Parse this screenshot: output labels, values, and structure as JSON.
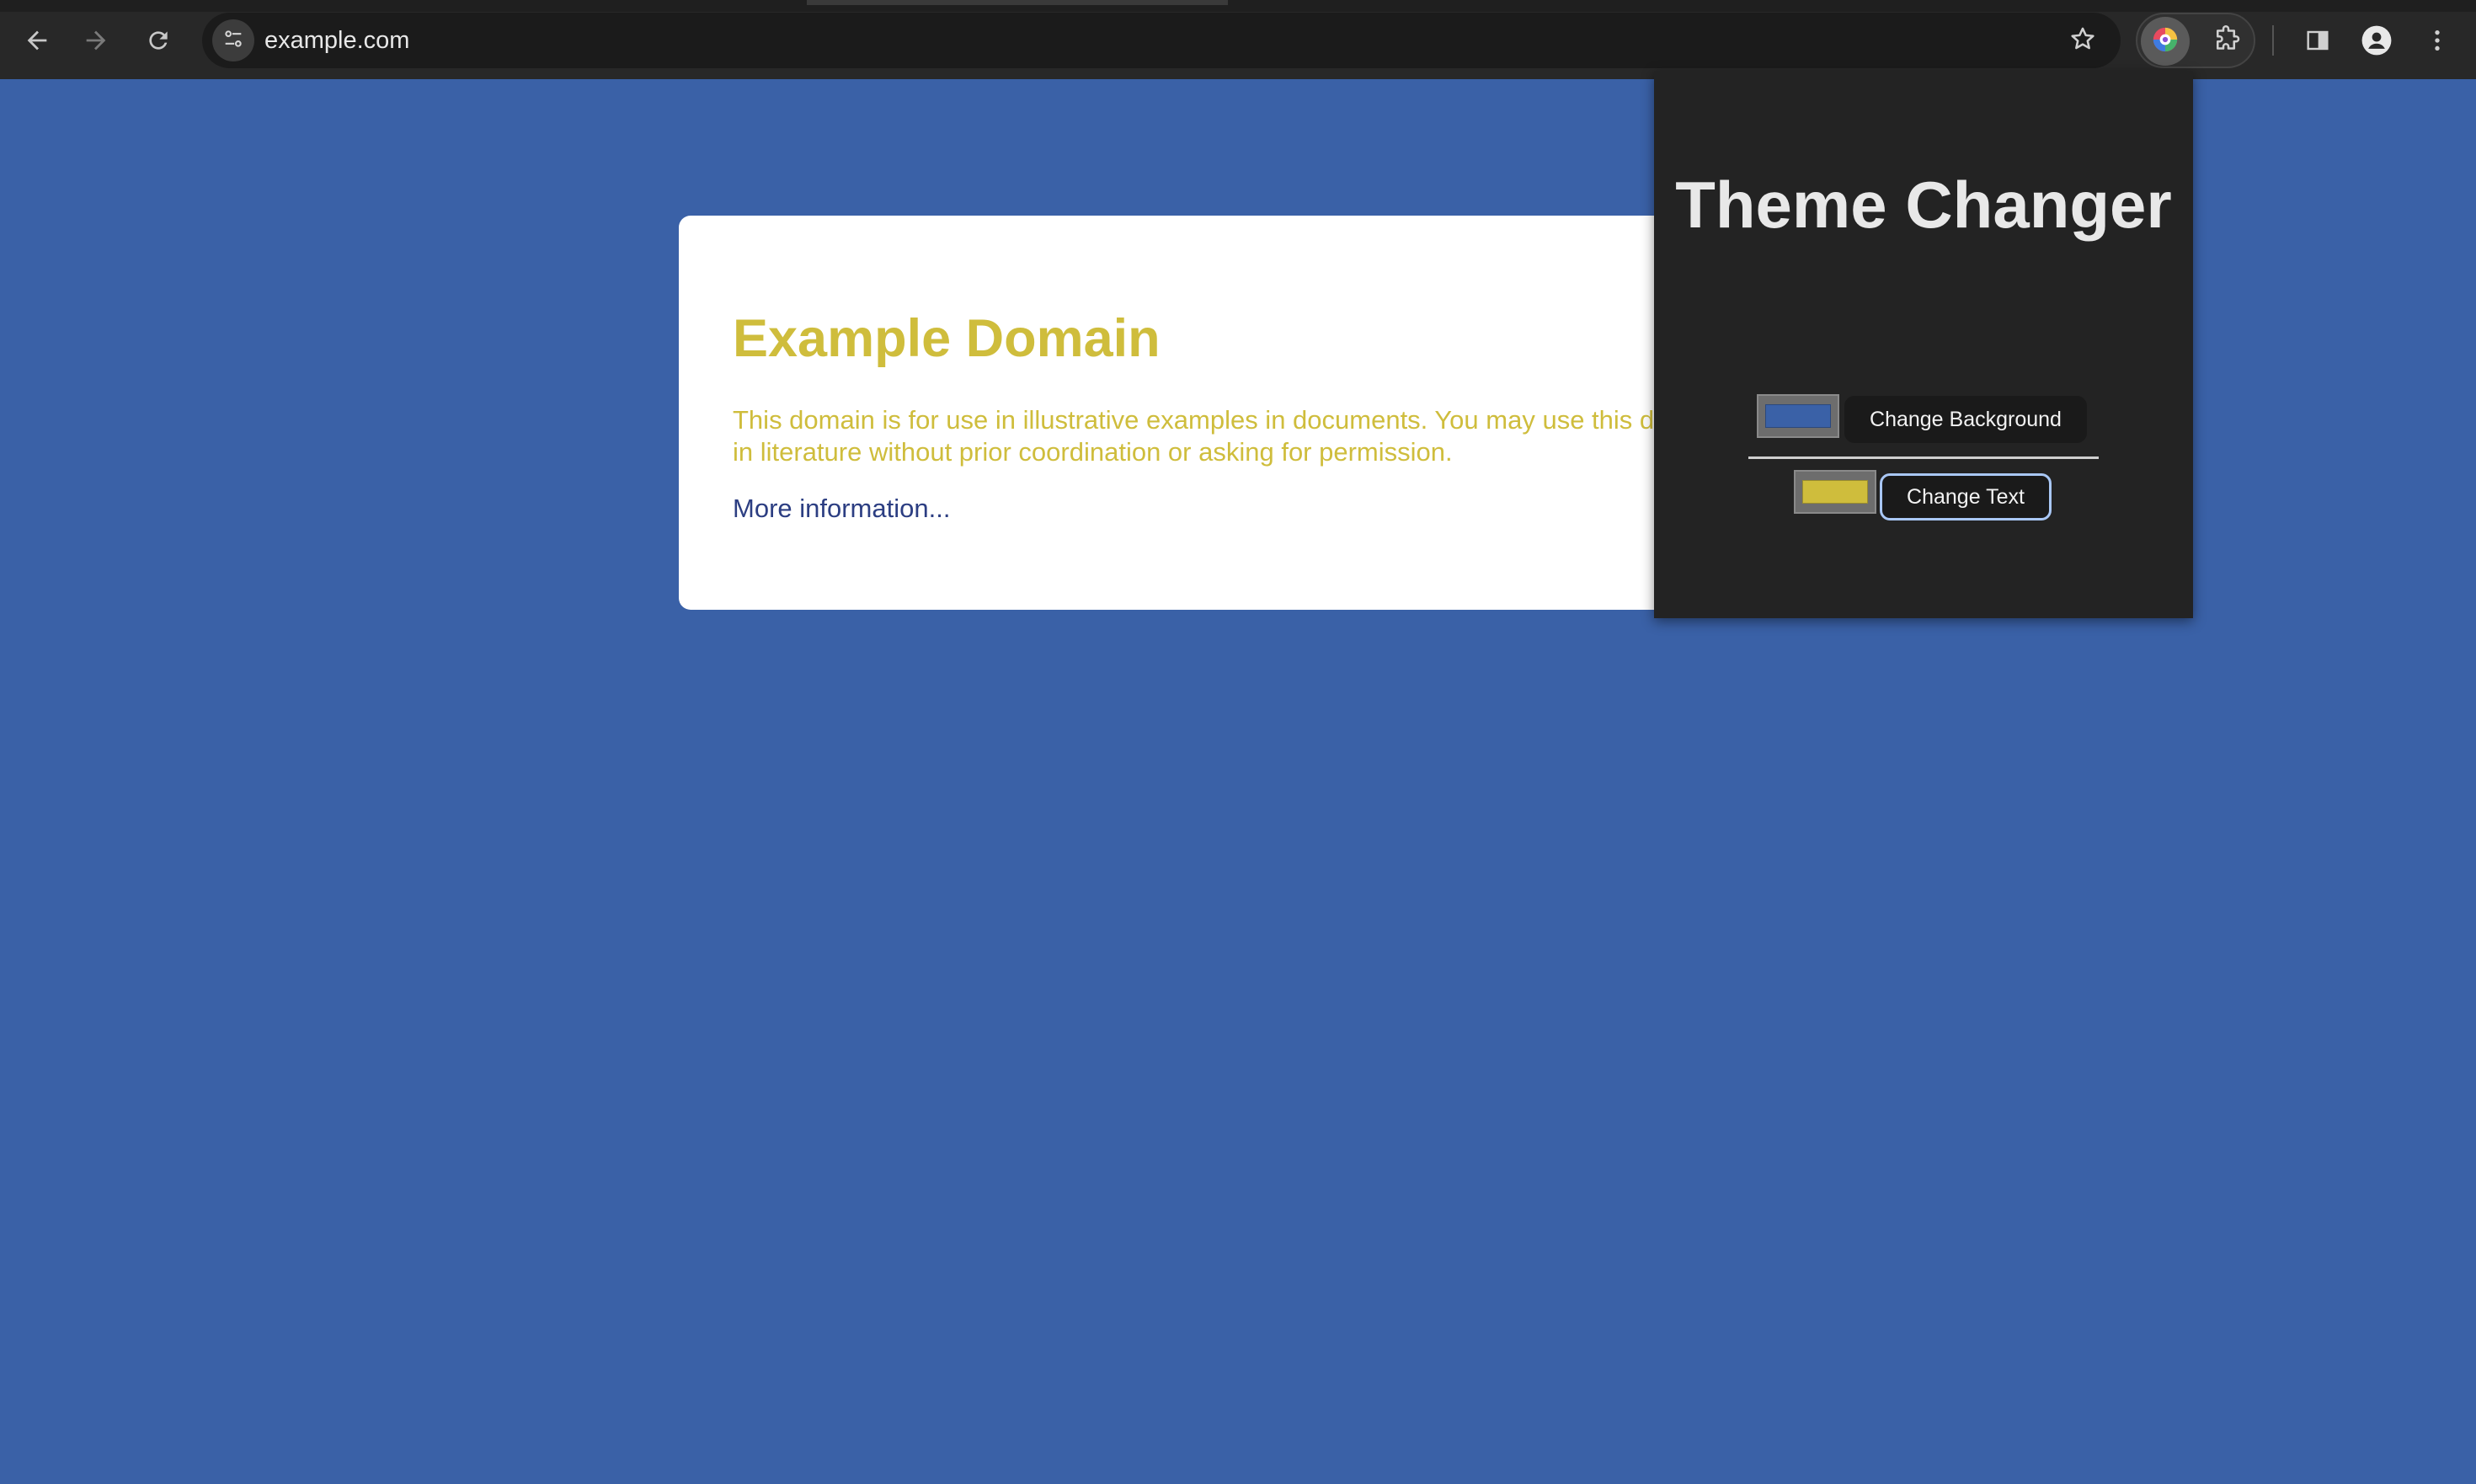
{
  "browser": {
    "url": "example.com",
    "icons": {
      "back": "arrow-left-icon",
      "forward": "arrow-right-icon",
      "reload": "reload-icon",
      "site_info": "tune-icon",
      "bookmark": "star-icon",
      "extension_theme": "color-wheel-icon",
      "extensions": "puzzle-icon",
      "side_panel": "side-panel-icon",
      "profile": "person-icon",
      "menu": "kebab-menu-icon"
    }
  },
  "page": {
    "title": "Example Domain",
    "paragraph": "This domain is for use in illustrative examples in documents. You may use this domain in literature without prior coordination or asking for permission.",
    "link_text": "More information...",
    "background_color": "#3a61a7",
    "text_color": "#cfbd3c",
    "link_color": "#2c3e82"
  },
  "popup": {
    "title": "Theme Changer",
    "background_swatch_color": "#3a61a7",
    "text_swatch_color": "#cfbd3c",
    "change_background_label": "Change Background",
    "change_text_label": "Change Text"
  }
}
